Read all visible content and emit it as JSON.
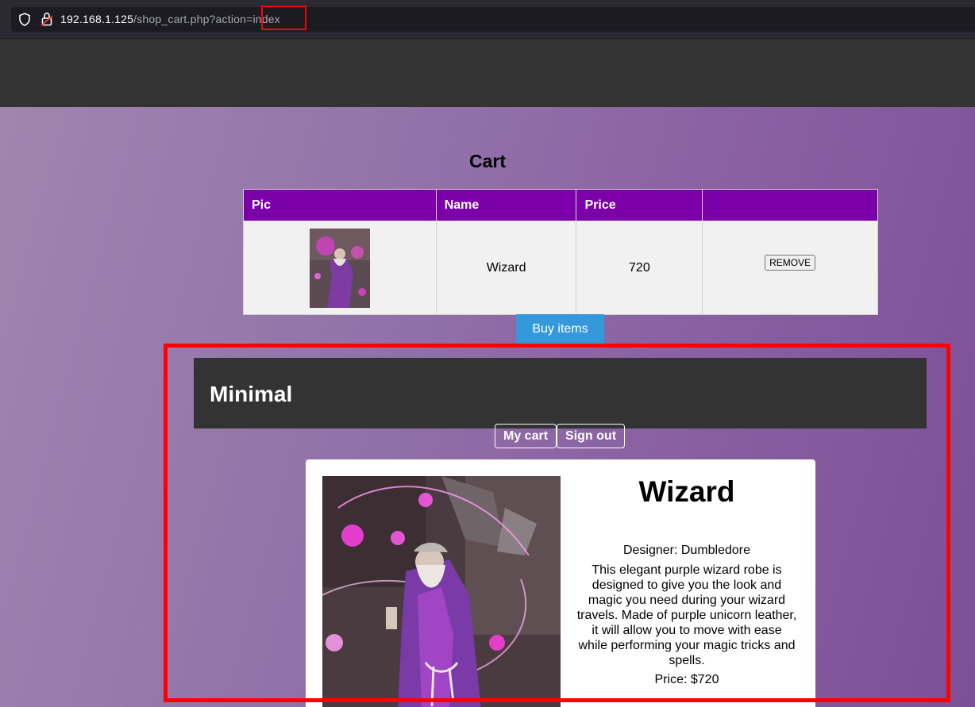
{
  "browser": {
    "url_host": "192.168.1.125",
    "url_path": "/shop_cart.php?action=index"
  },
  "cart": {
    "title": "Cart",
    "headers": [
      "Pic",
      "Name",
      "Price",
      ""
    ],
    "rows": [
      {
        "name": "Wizard",
        "price": "720",
        "remove_label": "REMOVE"
      }
    ],
    "buy_label": "Buy items"
  },
  "site": {
    "title": "Minimal",
    "nav": [
      "My cart",
      "Sign out"
    ]
  },
  "product": {
    "name": "Wizard",
    "designer": "Designer: Dumbledore",
    "description": "This elegant purple wizard robe is designed to give you the look and magic you need during your wizard travels. Made of purple unicorn leather, it will allow you to move with ease while performing your magic tricks and spells.",
    "price": "Price: $720"
  },
  "colors": {
    "table_header": "#7b00a9",
    "buy_button": "#3498db",
    "highlight": "#ff0000"
  }
}
